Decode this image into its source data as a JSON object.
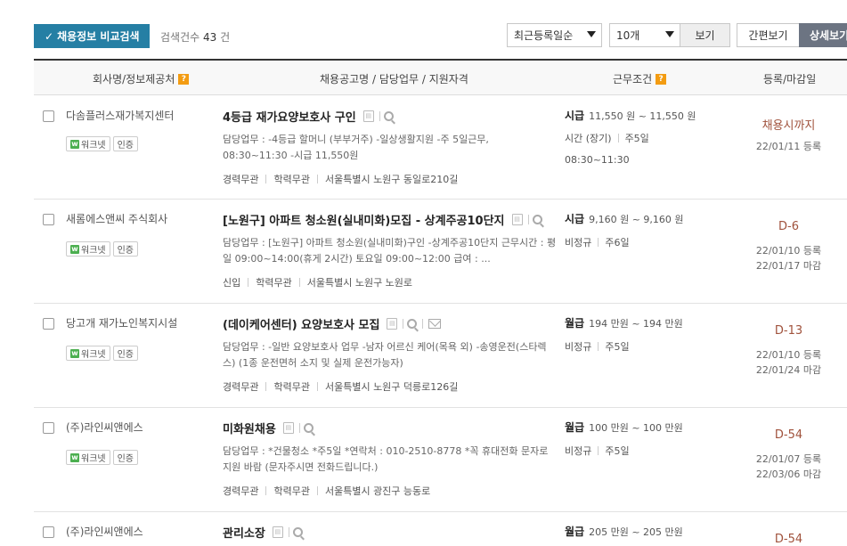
{
  "toolbar": {
    "compare_label": "채용정보 비교검색",
    "result_prefix": "검색건수",
    "result_count": "43",
    "result_unit": "건",
    "sort_value": "최근등록일순",
    "count_value": "10개",
    "view_label": "보기",
    "simple_label": "간편보기",
    "detail_label": "상세보기"
  },
  "header": {
    "col_company": "회사명/정보제공처",
    "col_job": "채용공고명 / 담당업무 / 지원자격",
    "col_cond": "근무조건",
    "col_date": "등록/마감일",
    "help_glyph": "?"
  },
  "jobs": [
    {
      "company": "다솜플러스재가복지센터",
      "badge_worknet": "워크넷",
      "badge_cert": "인증",
      "title": "4등급 재가요양보호사 구인",
      "duty": "담당업무 : -4등급 할머니 (부부거주) -일상생활지원 -주 5일근무, 08:30~11:30 -시급 11,550원",
      "tags": [
        "경력무관",
        "학력무관",
        "서울특별시 노원구 동일로210길"
      ],
      "pay_type": "시급",
      "pay": "11,550 원 ~ 11,550 원",
      "cond2a": "시간 (장기)",
      "cond2b": "주5일",
      "cond3": "08:30~11:30",
      "dday": "채용시까지",
      "reg": "22/01/11 등록",
      "due": ""
    },
    {
      "company": "새롬에스앤씨 주식회사",
      "badge_worknet": "워크넷",
      "badge_cert": "인증",
      "title": "[노원구] 아파트 청소원(실내미화)모집 - 상계주공10단지",
      "duty": "담당업무 : [노원구] 아파트 청소원(실내미화)구인 -상계주공10단지 근무시간 : 평일 09:00~14:00(휴게 2시간) 토요일 09:00~12:00 급여 : ...",
      "tags": [
        "신입",
        "학력무관",
        "서울특별시 노원구 노원로"
      ],
      "pay_type": "시급",
      "pay": "9,160 원 ~ 9,160 원",
      "cond2a": "비정규",
      "cond2b": "주6일",
      "cond3": "",
      "dday": "D-6",
      "reg": "22/01/10 등록",
      "due": "22/01/17 마감"
    },
    {
      "company": "당고개 재가노인복지시설",
      "badge_worknet": "워크넷",
      "badge_cert": "인증",
      "title": "(데이케어센터) 요양보호사 모집",
      "duty": "담당업무 : -일반 요양보호사 업무 -남자 어르신 케어(목욕 외) -송영운전(스타렉스) (1종 운전면허 소지 및 실제 운전가능자)",
      "tags": [
        "경력무관",
        "학력무관",
        "서울특별시 노원구 덕릉로126길"
      ],
      "pay_type": "월급",
      "pay": "194 만원 ~ 194 만원",
      "cond2a": "비정규",
      "cond2b": "주5일",
      "cond3": "",
      "dday": "D-13",
      "reg": "22/01/10 등록",
      "due": "22/01/24 마감"
    },
    {
      "company": "(주)라인씨앤에스",
      "badge_worknet": "워크넷",
      "badge_cert": "인증",
      "title": "미화원채용",
      "duty": "담당업무 : *건물청소 *주5일 *연락처 : 010-2510-8778 *꼭 휴대전화 문자로 지원 바람 (문자주시면 전화드립니다.)",
      "tags": [
        "경력무관",
        "학력무관",
        "서울특별시 광진구 능동로"
      ],
      "pay_type": "월급",
      "pay": "100 만원 ~ 100 만원",
      "cond2a": "비정규",
      "cond2b": "주5일",
      "cond3": "",
      "dday": "D-54",
      "reg": "22/01/07 등록",
      "due": "22/03/06 마감"
    },
    {
      "company": "(주)라인씨앤에스",
      "title": "관리소장",
      "pay_type": "월급",
      "pay": "205 만원 ~ 205 만원",
      "dday": "D-54"
    }
  ]
}
